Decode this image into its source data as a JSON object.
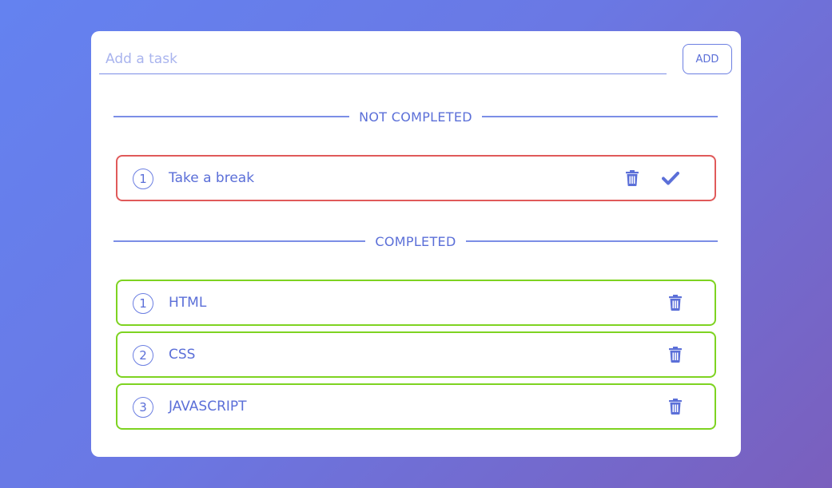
{
  "input": {
    "placeholder": "Add a task",
    "value": ""
  },
  "add_button": {
    "label": "ADD"
  },
  "sections": {
    "not_completed": {
      "label": "NOT COMPLETED",
      "tasks": [
        {
          "number": "1",
          "text": "Take a break"
        }
      ]
    },
    "completed": {
      "label": "COMPLETED",
      "tasks": [
        {
          "number": "1",
          "text": "HTML"
        },
        {
          "number": "2",
          "text": "CSS"
        },
        {
          "number": "3",
          "text": "JAVASCRIPT"
        }
      ]
    }
  },
  "icons": {
    "delete": "trash-icon",
    "complete": "check-icon"
  },
  "colors": {
    "accent": "#5b6fd8",
    "pending_border": "#e05a5a",
    "completed_border": "#7ed321",
    "background_start": "#6482f0",
    "background_end": "#7a5fbd"
  }
}
